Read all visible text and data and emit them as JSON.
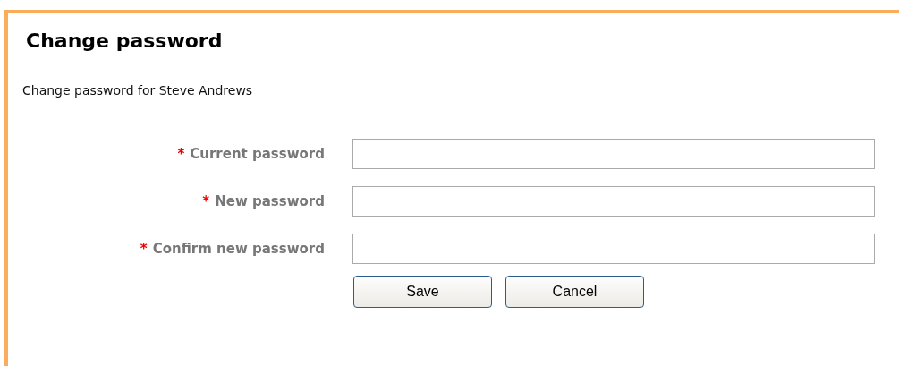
{
  "title": "Change password",
  "description": "Change password for Steve Andrews",
  "fields": [
    {
      "required_mark": "*",
      "label": "Current password"
    },
    {
      "required_mark": "*",
      "label": "New password"
    },
    {
      "required_mark": "*",
      "label": "Confirm new password"
    }
  ],
  "buttons": [
    "Save",
    "Cancel"
  ]
}
